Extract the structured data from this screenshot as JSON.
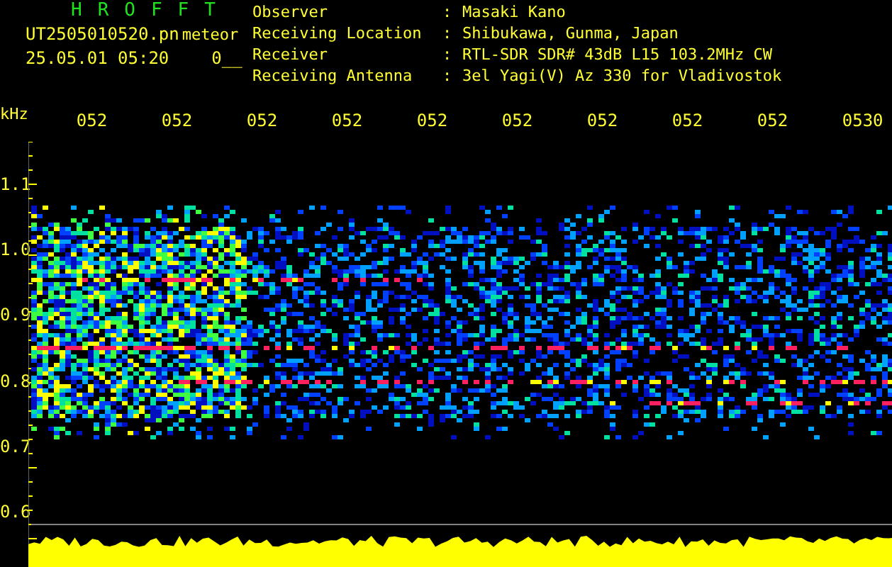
{
  "header": {
    "title": "HROFFT",
    "filename": "UT2505010520.pn",
    "mode": "meteor",
    "datetime": "25.05.01 05:20",
    "counter": "0__"
  },
  "info": [
    {
      "label": "Observer",
      "separator": ":",
      "value": "Masaki Kano"
    },
    {
      "label": "Receiving Location",
      "separator": ":",
      "value": "Shibukawa, Gunma, Japan"
    },
    {
      "label": "Receiver",
      "separator": ":",
      "value": "RTL-SDR SDR# 43dB L15 103.2MHz CW"
    },
    {
      "label": "Receiving Antenna",
      "separator": ":",
      "value": "3el Yagi(V) Az 330 for Vladivostok"
    }
  ],
  "y_unit": "kHz",
  "time_labels": [
    "052",
    "052",
    "052",
    "052",
    "052",
    "052",
    "052",
    "052",
    "052",
    "0530"
  ],
  "y_labels": [
    "1.1",
    "1.0",
    "0.9",
    "0.8",
    "0.7",
    "0.6"
  ]
}
